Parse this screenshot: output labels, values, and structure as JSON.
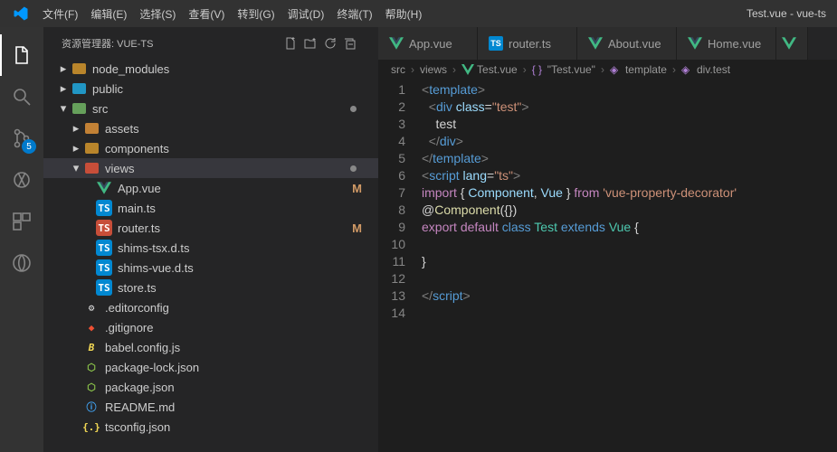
{
  "window_title": "Test.vue - vue-ts",
  "menu": [
    "文件(F)",
    "编辑(E)",
    "选择(S)",
    "查看(V)",
    "转到(G)",
    "调试(D)",
    "终端(T)",
    "帮助(H)"
  ],
  "activity": {
    "scm_badge": "5"
  },
  "sidebar": {
    "title": "资源管理器: VUE-TS",
    "tree": [
      {
        "indent": 0,
        "exp": false,
        "icon": "folder",
        "label": "node_modules"
      },
      {
        "indent": 0,
        "exp": false,
        "icon": "folder-blue",
        "label": "public"
      },
      {
        "indent": 0,
        "exp": true,
        "icon": "folder-green",
        "label": "src",
        "dot": true
      },
      {
        "indent": 1,
        "exp": false,
        "icon": "folder-orange",
        "label": "assets"
      },
      {
        "indent": 1,
        "exp": false,
        "icon": "folder",
        "label": "components"
      },
      {
        "indent": 1,
        "exp": true,
        "icon": "folder-red",
        "label": "views",
        "dot": true,
        "sel": true
      },
      {
        "indent": 2,
        "icon": "vue",
        "label": "App.vue",
        "status": "M"
      },
      {
        "indent": 2,
        "icon": "ts",
        "label": "main.ts"
      },
      {
        "indent": 2,
        "icon": "ts-red",
        "label": "router.ts",
        "status": "M"
      },
      {
        "indent": 2,
        "icon": "ts",
        "label": "shims-tsx.d.ts"
      },
      {
        "indent": 2,
        "icon": "ts",
        "label": "shims-vue.d.ts"
      },
      {
        "indent": 2,
        "icon": "ts",
        "label": "store.ts"
      },
      {
        "indent": 1,
        "icon": "editorconfig",
        "label": ".editorconfig"
      },
      {
        "indent": 1,
        "icon": "git",
        "label": ".gitignore"
      },
      {
        "indent": 1,
        "icon": "babel",
        "label": "babel.config.js"
      },
      {
        "indent": 1,
        "icon": "npm",
        "label": "package-lock.json"
      },
      {
        "indent": 1,
        "icon": "npm",
        "label": "package.json"
      },
      {
        "indent": 1,
        "icon": "readme",
        "label": "README.md"
      },
      {
        "indent": 1,
        "icon": "tsconfig",
        "label": "tsconfig.json"
      }
    ]
  },
  "tabs": [
    "App.vue",
    "router.ts",
    "About.vue",
    "Home.vue"
  ],
  "breadcrumbs": [
    {
      "label": "src"
    },
    {
      "label": "views"
    },
    {
      "icon": "vue",
      "label": "Test.vue"
    },
    {
      "icon": "brace",
      "label": "\"Test.vue\""
    },
    {
      "icon": "tag",
      "label": "template"
    },
    {
      "icon": "tag",
      "label": "div.test"
    }
  ],
  "code": {
    "lines": 14,
    "content": [
      [
        {
          "c": "c-tag",
          "t": "<"
        },
        {
          "c": "c-el",
          "t": "template"
        },
        {
          "c": "c-tag",
          "t": ">"
        }
      ],
      [
        {
          "c": "c-txt",
          "t": "  "
        },
        {
          "c": "c-tag",
          "t": "<"
        },
        {
          "c": "c-el",
          "t": "div"
        },
        {
          "c": "c-txt",
          "t": " "
        },
        {
          "c": "c-attr",
          "t": "class"
        },
        {
          "c": "c-txt",
          "t": "="
        },
        {
          "c": "c-str",
          "t": "\"test\""
        },
        {
          "c": "c-tag",
          "t": ">"
        }
      ],
      [
        {
          "c": "c-txt",
          "t": "    test"
        }
      ],
      [
        {
          "c": "c-txt",
          "t": "  "
        },
        {
          "c": "c-tag",
          "t": "</"
        },
        {
          "c": "c-el",
          "t": "div"
        },
        {
          "c": "c-tag",
          "t": ">"
        }
      ],
      [
        {
          "c": "c-tag",
          "t": "</"
        },
        {
          "c": "c-el",
          "t": "template"
        },
        {
          "c": "c-tag",
          "t": ">"
        }
      ],
      [
        {
          "c": "c-tag",
          "t": "<"
        },
        {
          "c": "c-el",
          "t": "script"
        },
        {
          "c": "c-txt",
          "t": " "
        },
        {
          "c": "c-attr",
          "t": "lang"
        },
        {
          "c": "c-txt",
          "t": "="
        },
        {
          "c": "c-str",
          "t": "\"ts\""
        },
        {
          "c": "c-tag",
          "t": ">"
        }
      ],
      [
        {
          "c": "c-kw",
          "t": "import"
        },
        {
          "c": "c-txt",
          "t": " { "
        },
        {
          "c": "c-attr",
          "t": "Component"
        },
        {
          "c": "c-txt",
          "t": ", "
        },
        {
          "c": "c-attr",
          "t": "Vue"
        },
        {
          "c": "c-txt",
          "t": " } "
        },
        {
          "c": "c-kw",
          "t": "from"
        },
        {
          "c": "c-txt",
          "t": " "
        },
        {
          "c": "c-str",
          "t": "'vue-property-decorator'"
        }
      ],
      [
        {
          "c": "c-txt",
          "t": "@"
        },
        {
          "c": "c-fn",
          "t": "Component"
        },
        {
          "c": "c-txt",
          "t": "({})"
        }
      ],
      [
        {
          "c": "c-kw",
          "t": "export"
        },
        {
          "c": "c-txt",
          "t": " "
        },
        {
          "c": "c-kw",
          "t": "default"
        },
        {
          "c": "c-txt",
          "t": " "
        },
        {
          "c": "c-el",
          "t": "class"
        },
        {
          "c": "c-txt",
          "t": " "
        },
        {
          "c": "c-ty",
          "t": "Test"
        },
        {
          "c": "c-txt",
          "t": " "
        },
        {
          "c": "c-el",
          "t": "extends"
        },
        {
          "c": "c-txt",
          "t": " "
        },
        {
          "c": "c-ty",
          "t": "Vue"
        },
        {
          "c": "c-txt",
          "t": " {"
        }
      ],
      [
        {
          "c": "c-txt",
          "t": ""
        }
      ],
      [
        {
          "c": "c-txt",
          "t": "}"
        }
      ],
      [
        {
          "c": "c-txt",
          "t": ""
        }
      ],
      [
        {
          "c": "c-tag",
          "t": "</"
        },
        {
          "c": "c-el",
          "t": "script"
        },
        {
          "c": "c-tag",
          "t": ">"
        }
      ],
      [
        {
          "c": "c-txt",
          "t": ""
        }
      ]
    ]
  }
}
